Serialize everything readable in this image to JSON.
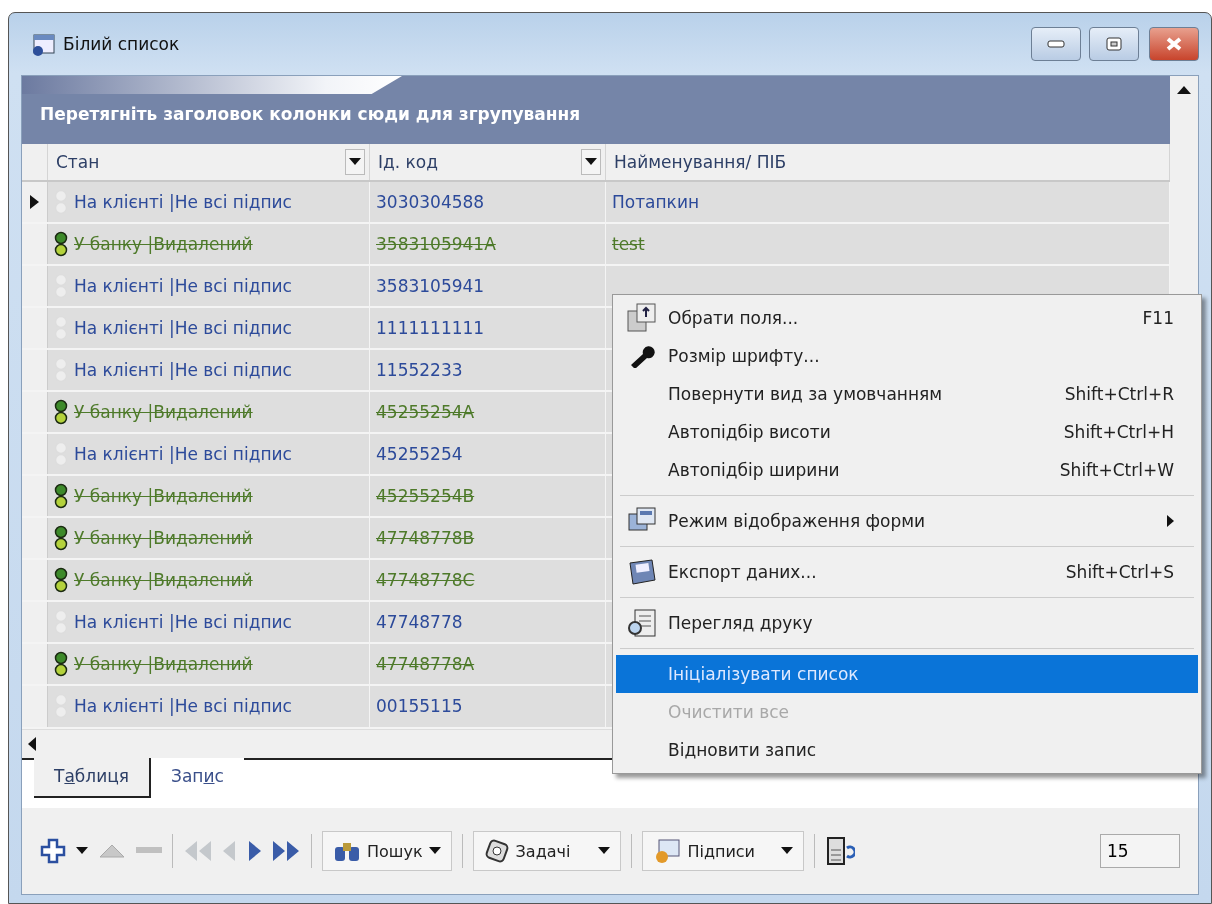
{
  "window": {
    "title": "Білий список"
  },
  "group_panel": {
    "text": "Перетягніть заголовок колонки сюди для згрупування"
  },
  "table": {
    "columns": [
      {
        "label": "Стан",
        "filter": true
      },
      {
        "label": "Ід. код",
        "filter": true
      },
      {
        "label": "Найменування/ ПІБ",
        "filter": false
      }
    ],
    "rows": [
      {
        "kind": "client",
        "selected": true,
        "deleted": false,
        "status": "На клієнті |Не всі підпис",
        "code": "3030304588",
        "name": "Потапкин"
      },
      {
        "kind": "bank",
        "selected": false,
        "deleted": true,
        "status": "У банку |Видалений",
        "code": "3583105941A",
        "name": "test"
      },
      {
        "kind": "client",
        "selected": false,
        "deleted": false,
        "status": "На клієнті |Не всі підпис",
        "code": "3583105941"
      },
      {
        "kind": "client",
        "selected": false,
        "deleted": false,
        "status": "На клієнті |Не всі підпис",
        "code": "1111111111"
      },
      {
        "kind": "client",
        "selected": false,
        "deleted": false,
        "status": "На клієнті |Не всі підпис",
        "code": "11552233"
      },
      {
        "kind": "bank",
        "selected": false,
        "deleted": true,
        "status": "У банку |Видалений",
        "code": "45255254A"
      },
      {
        "kind": "client",
        "selected": false,
        "deleted": false,
        "status": "На клієнті |Не всі підпис",
        "code": "45255254"
      },
      {
        "kind": "bank",
        "selected": false,
        "deleted": true,
        "status": "У банку |Видалений",
        "code": "45255254B"
      },
      {
        "kind": "bank",
        "selected": false,
        "deleted": true,
        "status": "У банку |Видалений",
        "code": "47748778B"
      },
      {
        "kind": "bank",
        "selected": false,
        "deleted": true,
        "status": "У банку |Видалений",
        "code": "47748778C"
      },
      {
        "kind": "client",
        "selected": false,
        "deleted": false,
        "status": "На клієнті |Не всі підпис",
        "code": "47748778"
      },
      {
        "kind": "bank",
        "selected": false,
        "deleted": true,
        "status": "У банку |Видалений",
        "code": "47748778A"
      },
      {
        "kind": "client",
        "selected": false,
        "deleted": false,
        "status": "На клієнті |Не всі підпис",
        "code": "00155115"
      }
    ]
  },
  "context_menu": {
    "items": [
      {
        "kind": "item",
        "label": "Обрати поля...",
        "shortcut": "F11",
        "selected": false,
        "disabled": false
      },
      {
        "kind": "item",
        "label": "Розмір шрифту...",
        "selected": false,
        "disabled": false
      },
      {
        "kind": "item",
        "label": "Повернути вид за умовчанням",
        "shortcut": "Shift+Ctrl+R",
        "selected": false,
        "disabled": false
      },
      {
        "kind": "item",
        "label": "Автопідбір висоти",
        "shortcut": "Shift+Ctrl+H",
        "selected": false,
        "disabled": false
      },
      {
        "kind": "item",
        "label": "Автопідбір ширини",
        "shortcut": "Shift+Ctrl+W",
        "selected": false,
        "disabled": false
      },
      {
        "kind": "separator"
      },
      {
        "kind": "submenu",
        "label": "Режим відображення форми",
        "selected": false,
        "disabled": false
      },
      {
        "kind": "separator"
      },
      {
        "kind": "item",
        "label": "Експорт даних...",
        "shortcut": "Shift+Ctrl+S",
        "selected": false,
        "disabled": false
      },
      {
        "kind": "separator"
      },
      {
        "kind": "item",
        "label": "Перегляд друку",
        "selected": false,
        "disabled": false
      },
      {
        "kind": "separator"
      },
      {
        "kind": "item",
        "label": "Ініціалізувати список",
        "selected": true,
        "disabled": false
      },
      {
        "kind": "item",
        "label": "Очистити все",
        "selected": false,
        "disabled": true
      },
      {
        "kind": "item",
        "label": "Відновити запис",
        "selected": false,
        "disabled": false
      }
    ]
  },
  "tabs": [
    {
      "label": [
        "Т",
        "а",
        "блиця"
      ],
      "selected": true
    },
    {
      "label": [
        "Зап",
        "и",
        "с"
      ],
      "selected": false
    }
  ],
  "toolbar": {
    "search_label": "Пошук",
    "tasks_label": "Задачі",
    "signatures_label": "Підписи",
    "count": "15"
  }
}
